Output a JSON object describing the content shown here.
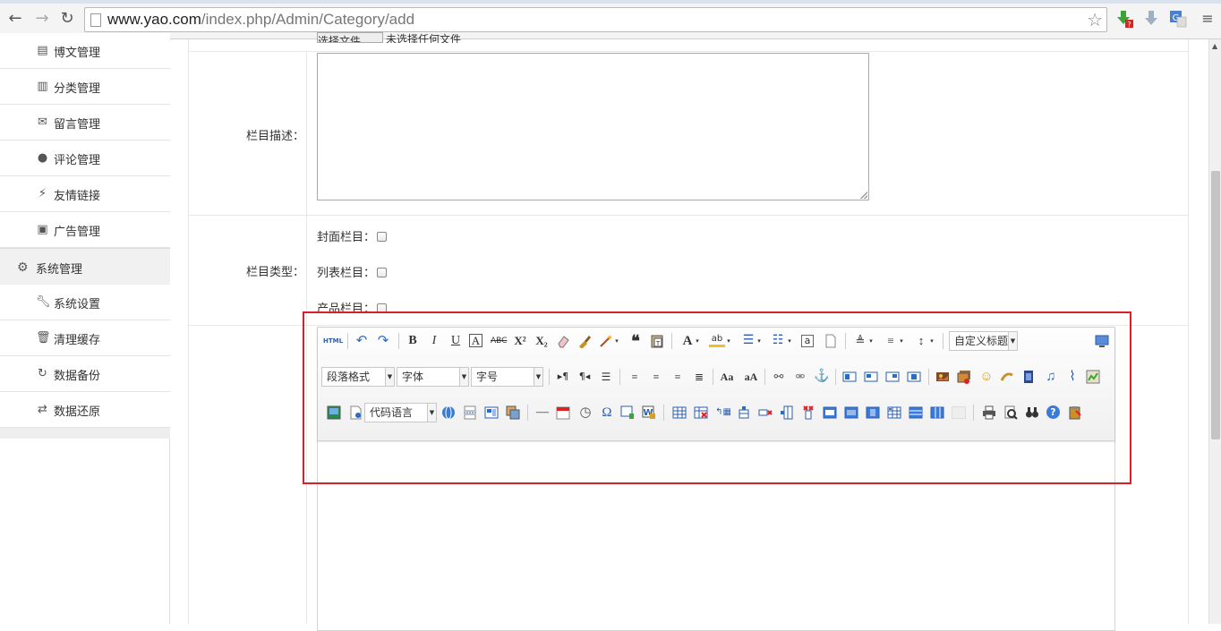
{
  "browser": {
    "url_host": "www.yao.com",
    "url_path": "/index.php/Admin/Category/add"
  },
  "sidebar": {
    "items_top": [
      {
        "label": "博文管理",
        "icon": "list-icon"
      },
      {
        "label": "分类管理",
        "icon": "books-icon"
      },
      {
        "label": "留言管理",
        "icon": "mail-icon"
      },
      {
        "label": "评论管理",
        "icon": "comment-icon"
      },
      {
        "label": "友情链接",
        "icon": "plug-icon"
      },
      {
        "label": "广告管理",
        "icon": "picture-icon"
      }
    ],
    "group": {
      "label": "系统管理",
      "icon": "gear-icon"
    },
    "items_bottom": [
      {
        "label": "系统设置",
        "icon": "wrench-icon"
      },
      {
        "label": "清理缓存",
        "icon": "trash-icon"
      },
      {
        "label": "数据备份",
        "icon": "refresh-icon"
      },
      {
        "label": "数据还原",
        "icon": "retweet-icon"
      }
    ]
  },
  "form": {
    "desc_label": "栏目描述：",
    "type_label": "栏目类型：",
    "file_button": "选择文件",
    "file_text": "未选择任何文件",
    "checkboxes": [
      {
        "label": "封面栏目：",
        "checked": false
      },
      {
        "label": "列表栏目：",
        "checked": false
      },
      {
        "label": "产品栏目：",
        "checked": false
      }
    ]
  },
  "editor": {
    "custom_heading": "自定义标题",
    "paragraph_format": "段落格式",
    "font_family": "字体",
    "font_size": "字号",
    "code_language": "代码语言",
    "html_label": "HTML",
    "highlight_color": "#d9202a"
  }
}
